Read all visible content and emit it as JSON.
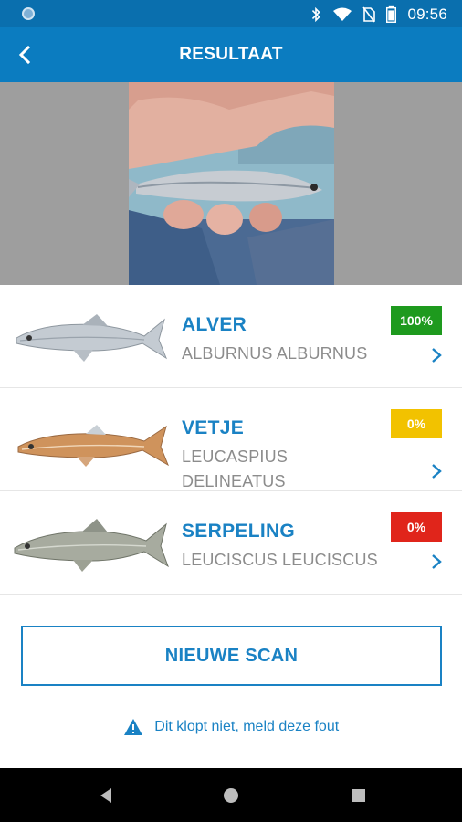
{
  "status_bar": {
    "time": "09:56",
    "icons": [
      "camera-notification-icon",
      "bluetooth-icon",
      "wifi-icon",
      "no-sim-icon",
      "battery-icon"
    ]
  },
  "app_bar": {
    "title": "RESULTAAT",
    "back_icon": "arrow-back-icon"
  },
  "results": [
    {
      "name": "ALVER",
      "latin": "ALBURNUS ALBURNUS",
      "score": "100%",
      "badge_color": "#1e9a1e",
      "fish_tint": "#b9c1c8"
    },
    {
      "name": "VETJE",
      "latin": "LEUCASPIUS DELINEATUS",
      "score": "0%",
      "badge_color": "#f2c200",
      "fish_tint": "#c98a55"
    },
    {
      "name": "SERPELING",
      "latin": "LEUCISCUS LEUCISCUS",
      "score": "0%",
      "badge_color": "#e0251b",
      "fish_tint": "#9ea39b"
    }
  ],
  "actions": {
    "new_scan": "NIEUWE SCAN",
    "report": "Dit klopt niet, meld deze fout"
  },
  "colors": {
    "primary": "#0b7cc0",
    "status": "#0a6fae",
    "accent_text": "#1a82c4"
  },
  "nav": [
    "back-triangle-icon",
    "home-circle-icon",
    "recents-square-icon"
  ]
}
